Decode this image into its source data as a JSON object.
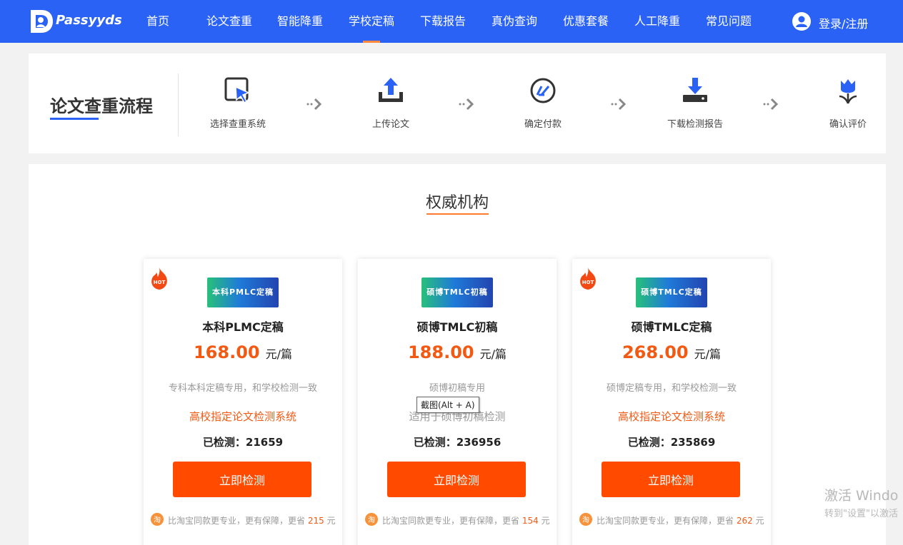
{
  "nav": {
    "logo_text": "Passyyds",
    "items": [
      {
        "label": "首页"
      },
      {
        "label": "论文查重"
      },
      {
        "label": "智能降重"
      },
      {
        "label": "学校定稿"
      },
      {
        "label": "下载报告"
      },
      {
        "label": "真伪查询"
      },
      {
        "label": "优惠套餐"
      },
      {
        "label": "人工降重"
      },
      {
        "label": "常见问题"
      }
    ],
    "active_item": "学校定稿",
    "login_label": "登录/注册"
  },
  "process": {
    "title": "论文查重流程",
    "steps": [
      {
        "label": "选择查重系统",
        "icon": "cursor-click-icon"
      },
      {
        "label": "上传论文",
        "icon": "upload-icon"
      },
      {
        "label": "确定付款",
        "icon": "payment-icon"
      },
      {
        "label": "下载检测报告",
        "icon": "download-icon"
      },
      {
        "label": "确认评价",
        "icon": "tulip-icon"
      }
    ]
  },
  "section": {
    "title": "权威机构"
  },
  "cards": [
    {
      "hot": true,
      "banner": "本科PMLC定稿",
      "name": "本科PLMC定稿",
      "price": "168.00",
      "unit": "元/篇",
      "desc": "专科本科定稿专用，和学校检测一致",
      "feature": "高校指定论文检测系统",
      "count_label": "已检测：21659",
      "button": "立即检测",
      "taobao_text": "比淘宝同款更专业，更有保障，更省",
      "taobao_save": "215",
      "taobao_unit": "元"
    },
    {
      "hot": false,
      "banner": "硕博TMLC初稿",
      "name": "硕博TMLC初稿",
      "price": "188.00",
      "unit": "元/篇",
      "desc": "硕博初稿专用",
      "feature": "适用于硕博初稿检测",
      "count_label": "已检测：236956",
      "button": "立即检测",
      "taobao_text": "比淘宝同款更专业，更有保障，更省",
      "taobao_save": "154",
      "taobao_unit": "元"
    },
    {
      "hot": true,
      "banner": "硕博TMLC定稿",
      "name": "硕博TMLC定稿",
      "price": "268.00",
      "unit": "元/篇",
      "desc": "硕博定稿专用，和学校检测一致",
      "feature": "高校指定论文检测系统",
      "count_label": "已检测：235869",
      "button": "立即检测",
      "taobao_text": "比淘宝同款更专业，更有保障，更省",
      "taobao_save": "262",
      "taobao_unit": "元"
    }
  ],
  "tooltip": "截图(Alt + A)",
  "watermark": {
    "line1": "激活 Windo",
    "line2": "转到\"设置\"以激活"
  },
  "colors": {
    "nav_bg": "#2a62f5",
    "accent_orange": "#ff4a00",
    "price": "#f25a14"
  }
}
